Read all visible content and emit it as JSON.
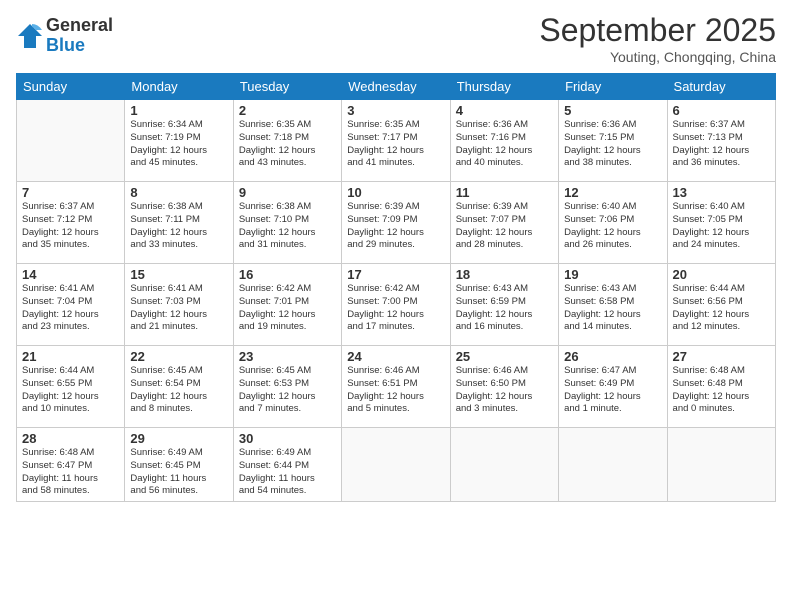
{
  "logo": {
    "general": "General",
    "blue": "Blue"
  },
  "header": {
    "month": "September 2025",
    "location": "Youting, Chongqing, China"
  },
  "weekdays": [
    "Sunday",
    "Monday",
    "Tuesday",
    "Wednesday",
    "Thursday",
    "Friday",
    "Saturday"
  ],
  "weeks": [
    [
      {
        "day": "",
        "info": ""
      },
      {
        "day": "1",
        "info": "Sunrise: 6:34 AM\nSunset: 7:19 PM\nDaylight: 12 hours\nand 45 minutes."
      },
      {
        "day": "2",
        "info": "Sunrise: 6:35 AM\nSunset: 7:18 PM\nDaylight: 12 hours\nand 43 minutes."
      },
      {
        "day": "3",
        "info": "Sunrise: 6:35 AM\nSunset: 7:17 PM\nDaylight: 12 hours\nand 41 minutes."
      },
      {
        "day": "4",
        "info": "Sunrise: 6:36 AM\nSunset: 7:16 PM\nDaylight: 12 hours\nand 40 minutes."
      },
      {
        "day": "5",
        "info": "Sunrise: 6:36 AM\nSunset: 7:15 PM\nDaylight: 12 hours\nand 38 minutes."
      },
      {
        "day": "6",
        "info": "Sunrise: 6:37 AM\nSunset: 7:13 PM\nDaylight: 12 hours\nand 36 minutes."
      }
    ],
    [
      {
        "day": "7",
        "info": "Sunrise: 6:37 AM\nSunset: 7:12 PM\nDaylight: 12 hours\nand 35 minutes."
      },
      {
        "day": "8",
        "info": "Sunrise: 6:38 AM\nSunset: 7:11 PM\nDaylight: 12 hours\nand 33 minutes."
      },
      {
        "day": "9",
        "info": "Sunrise: 6:38 AM\nSunset: 7:10 PM\nDaylight: 12 hours\nand 31 minutes."
      },
      {
        "day": "10",
        "info": "Sunrise: 6:39 AM\nSunset: 7:09 PM\nDaylight: 12 hours\nand 29 minutes."
      },
      {
        "day": "11",
        "info": "Sunrise: 6:39 AM\nSunset: 7:07 PM\nDaylight: 12 hours\nand 28 minutes."
      },
      {
        "day": "12",
        "info": "Sunrise: 6:40 AM\nSunset: 7:06 PM\nDaylight: 12 hours\nand 26 minutes."
      },
      {
        "day": "13",
        "info": "Sunrise: 6:40 AM\nSunset: 7:05 PM\nDaylight: 12 hours\nand 24 minutes."
      }
    ],
    [
      {
        "day": "14",
        "info": "Sunrise: 6:41 AM\nSunset: 7:04 PM\nDaylight: 12 hours\nand 23 minutes."
      },
      {
        "day": "15",
        "info": "Sunrise: 6:41 AM\nSunset: 7:03 PM\nDaylight: 12 hours\nand 21 minutes."
      },
      {
        "day": "16",
        "info": "Sunrise: 6:42 AM\nSunset: 7:01 PM\nDaylight: 12 hours\nand 19 minutes."
      },
      {
        "day": "17",
        "info": "Sunrise: 6:42 AM\nSunset: 7:00 PM\nDaylight: 12 hours\nand 17 minutes."
      },
      {
        "day": "18",
        "info": "Sunrise: 6:43 AM\nSunset: 6:59 PM\nDaylight: 12 hours\nand 16 minutes."
      },
      {
        "day": "19",
        "info": "Sunrise: 6:43 AM\nSunset: 6:58 PM\nDaylight: 12 hours\nand 14 minutes."
      },
      {
        "day": "20",
        "info": "Sunrise: 6:44 AM\nSunset: 6:56 PM\nDaylight: 12 hours\nand 12 minutes."
      }
    ],
    [
      {
        "day": "21",
        "info": "Sunrise: 6:44 AM\nSunset: 6:55 PM\nDaylight: 12 hours\nand 10 minutes."
      },
      {
        "day": "22",
        "info": "Sunrise: 6:45 AM\nSunset: 6:54 PM\nDaylight: 12 hours\nand 8 minutes."
      },
      {
        "day": "23",
        "info": "Sunrise: 6:45 AM\nSunset: 6:53 PM\nDaylight: 12 hours\nand 7 minutes."
      },
      {
        "day": "24",
        "info": "Sunrise: 6:46 AM\nSunset: 6:51 PM\nDaylight: 12 hours\nand 5 minutes."
      },
      {
        "day": "25",
        "info": "Sunrise: 6:46 AM\nSunset: 6:50 PM\nDaylight: 12 hours\nand 3 minutes."
      },
      {
        "day": "26",
        "info": "Sunrise: 6:47 AM\nSunset: 6:49 PM\nDaylight: 12 hours\nand 1 minute."
      },
      {
        "day": "27",
        "info": "Sunrise: 6:48 AM\nSunset: 6:48 PM\nDaylight: 12 hours\nand 0 minutes."
      }
    ],
    [
      {
        "day": "28",
        "info": "Sunrise: 6:48 AM\nSunset: 6:47 PM\nDaylight: 11 hours\nand 58 minutes."
      },
      {
        "day": "29",
        "info": "Sunrise: 6:49 AM\nSunset: 6:45 PM\nDaylight: 11 hours\nand 56 minutes."
      },
      {
        "day": "30",
        "info": "Sunrise: 6:49 AM\nSunset: 6:44 PM\nDaylight: 11 hours\nand 54 minutes."
      },
      {
        "day": "",
        "info": ""
      },
      {
        "day": "",
        "info": ""
      },
      {
        "day": "",
        "info": ""
      },
      {
        "day": "",
        "info": ""
      }
    ]
  ]
}
